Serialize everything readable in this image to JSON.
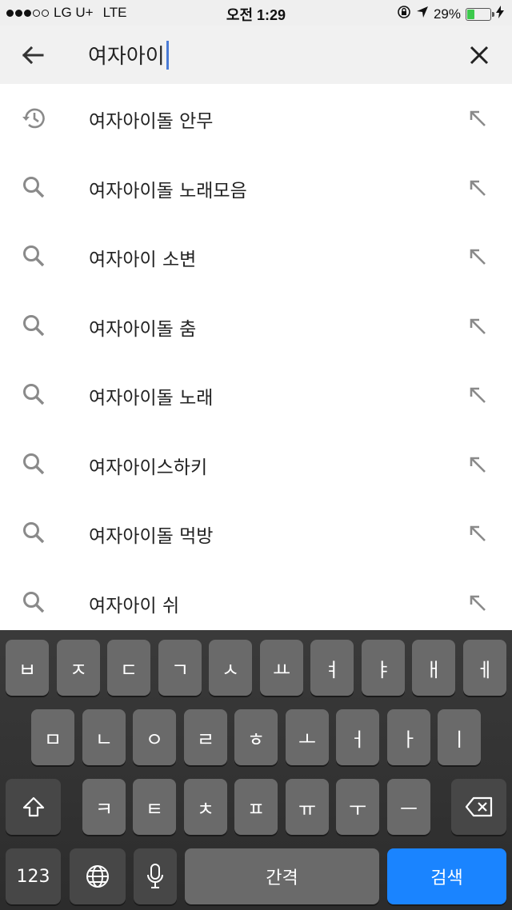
{
  "status_bar": {
    "carrier": "LG U+",
    "network": "LTE",
    "time": "오전 1:29",
    "battery": "29%",
    "battery_level": 0.29
  },
  "search": {
    "query": "여자아이",
    "back_icon": "arrow-left-icon",
    "clear_icon": "close-icon"
  },
  "suggestions": [
    {
      "label": "여자아이돌 안무",
      "icon": "history-icon"
    },
    {
      "label": "여자아이돌 노래모음",
      "icon": "search-icon"
    },
    {
      "label": "여자아이 소변",
      "icon": "search-icon"
    },
    {
      "label": "여자아이돌 춤",
      "icon": "search-icon"
    },
    {
      "label": "여자아이돌 노래",
      "icon": "search-icon"
    },
    {
      "label": "여자아이스하키",
      "icon": "search-icon"
    },
    {
      "label": "여자아이돌 먹방",
      "icon": "search-icon"
    },
    {
      "label": "여자아이 쉬",
      "icon": "search-icon"
    }
  ],
  "keyboard": {
    "row1": [
      "ㅂ",
      "ㅈ",
      "ㄷ",
      "ㄱ",
      "ㅅ",
      "ㅛ",
      "ㅕ",
      "ㅑ",
      "ㅐ",
      "ㅔ"
    ],
    "row2": [
      "ㅁ",
      "ㄴ",
      "ㅇ",
      "ㄹ",
      "ㅎ",
      "ㅗ",
      "ㅓ",
      "ㅏ",
      "ㅣ"
    ],
    "row3": [
      "ㅋ",
      "ㅌ",
      "ㅊ",
      "ㅍ",
      "ㅠ",
      "ㅜ",
      "ㅡ"
    ],
    "numbers_label": "123",
    "space_label": "간격",
    "search_label": "검색",
    "accent_color": "#1a84ff"
  }
}
